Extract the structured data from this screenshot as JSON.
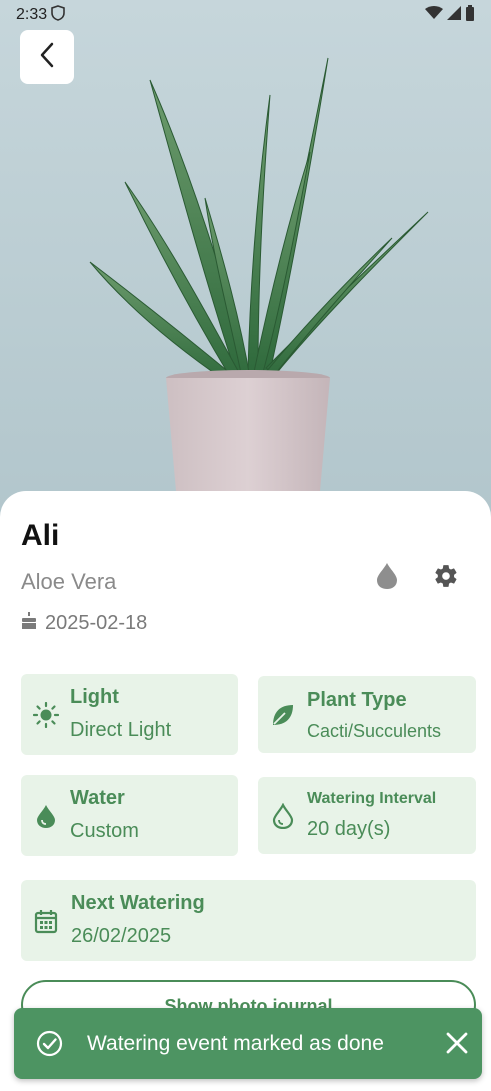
{
  "status_bar": {
    "time": "2:33"
  },
  "plant": {
    "name": "Ali",
    "species": "Aloe Vera",
    "birth_date": "2025-02-18"
  },
  "cards": {
    "light": {
      "title": "Light",
      "value": "Direct Light"
    },
    "plant_type": {
      "title": "Plant Type",
      "value": "Cacti/Succulents"
    },
    "water": {
      "title": "Water",
      "value": "Custom"
    },
    "watering_interval": {
      "title": "Watering Interval",
      "value": "20 day(s)"
    },
    "next_watering": {
      "title": "Next Watering",
      "value": "26/02/2025"
    }
  },
  "journal_button": {
    "label": "Show photo journal"
  },
  "snackbar": {
    "message": "Watering event marked as done"
  },
  "colors": {
    "accent": "#4a8c58",
    "card_bg": "#e8f3e8",
    "snackbar_bg": "#4d9462"
  }
}
